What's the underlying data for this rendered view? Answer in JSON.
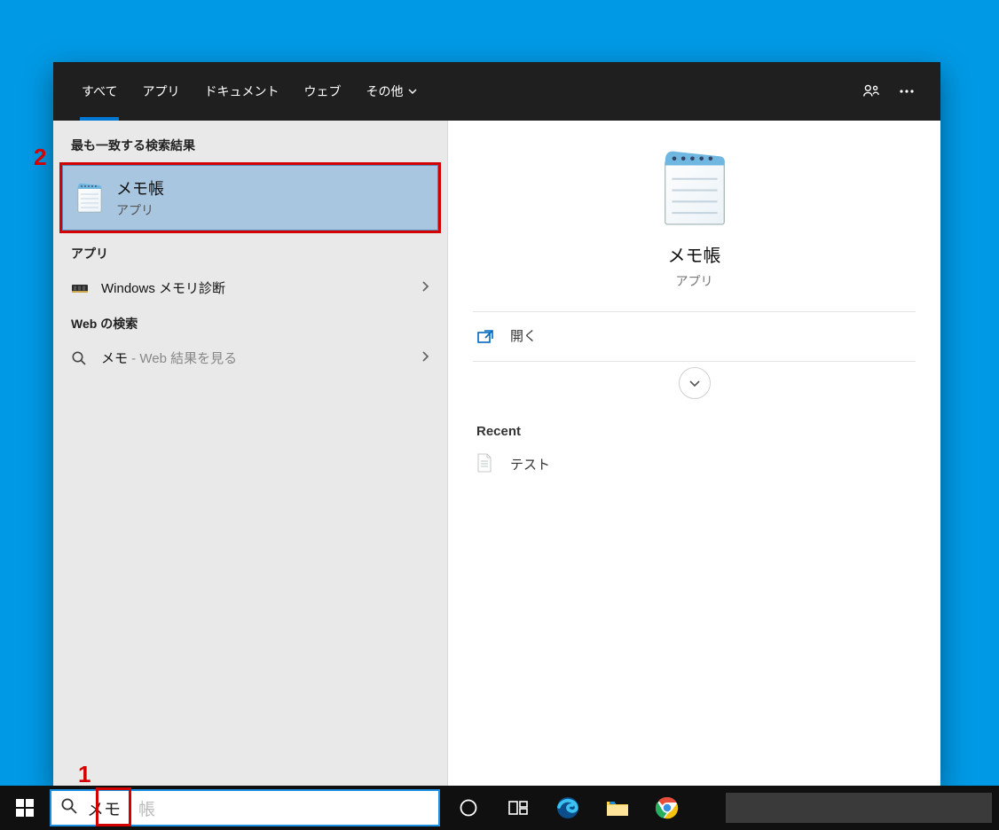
{
  "tabs": {
    "all": "すべて",
    "apps": "アプリ",
    "documents": "ドキュメント",
    "web": "ウェブ",
    "more": "その他"
  },
  "left": {
    "best_match_header": "最も一致する検索結果",
    "best_match": {
      "title": "メモ帳",
      "subtitle": "アプリ"
    },
    "apps_header": "アプリ",
    "app_result": {
      "label": "Windows メモリ診断"
    },
    "web_header": "Web の検索",
    "web_result": {
      "prefix": "メモ",
      "suffix": " - Web 結果を見る"
    }
  },
  "preview": {
    "title": "メモ帳",
    "subtitle": "アプリ",
    "open_label": "開く",
    "recent_header": "Recent",
    "recent_item": "テスト"
  },
  "search": {
    "value": "メモ",
    "ghost": "帳"
  },
  "annotations": {
    "one": "1",
    "two": "2"
  }
}
